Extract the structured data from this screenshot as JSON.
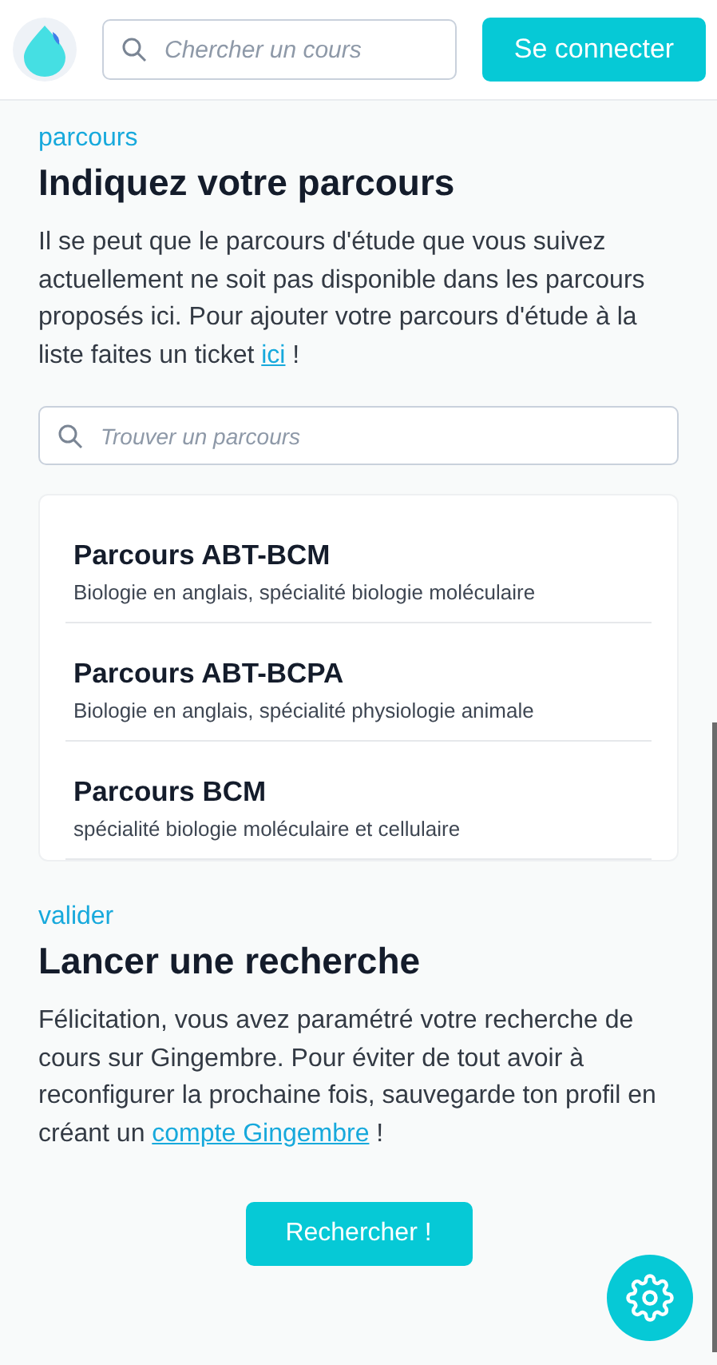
{
  "header": {
    "search": {
      "placeholder": "Chercher un cours"
    },
    "login_button": "Se connecter"
  },
  "sections": [
    {
      "kind": "parcours",
      "eyebrow": "parcours",
      "title": "Indiquez votre parcours",
      "text_before": "Il se peut que le parcours d'étude que vous suivez actuellement ne soit pas disponible dans les parcours proposés ici. Pour ajouter votre parcours d'étude à la liste faites un ticket ",
      "link": "ici",
      "text_after": " !",
      "search": {
        "placeholder": "Trouver un parcours"
      },
      "items": [
        {
          "name": "Parcours ABT-BCM",
          "description": "Biologie en anglais, spécialité biologie moléculaire"
        },
        {
          "name": "Parcours ABT-BCPA",
          "description": "Biologie en anglais, spécialité physiologie animale"
        },
        {
          "name": "Parcours BCM",
          "description": "spécialité biologie moléculaire et cellulaire"
        }
      ]
    },
    {
      "kind": "valider",
      "eyebrow": "valider",
      "title": "Lancer une recherche",
      "text_before": "Félicitation, vous avez paramétré votre recherche de cours sur Gingembre. Pour éviter de tout avoir à reconfigurer la prochaine fois, sauvegarde ton profil en créant un ",
      "link": "compte Gingembre",
      "text_after": " !",
      "button": "Rechercher !"
    }
  ]
}
